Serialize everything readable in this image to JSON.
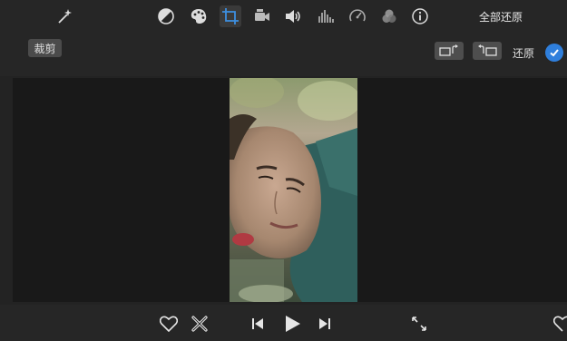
{
  "toolbar": {
    "icons": [
      "magic-wand-icon",
      "color-balance-icon",
      "palette-icon",
      "crop-icon",
      "camera-icon",
      "volume-icon",
      "equalizer-icon",
      "speed-icon",
      "filter-icon",
      "info-icon"
    ],
    "reset_all_label": "全部还原"
  },
  "crop": {
    "mode_label": "裁剪",
    "reset_label": "还原"
  },
  "colors": {
    "accent": "#2f7fdc",
    "background": "#232323",
    "viewer": "#191919"
  }
}
